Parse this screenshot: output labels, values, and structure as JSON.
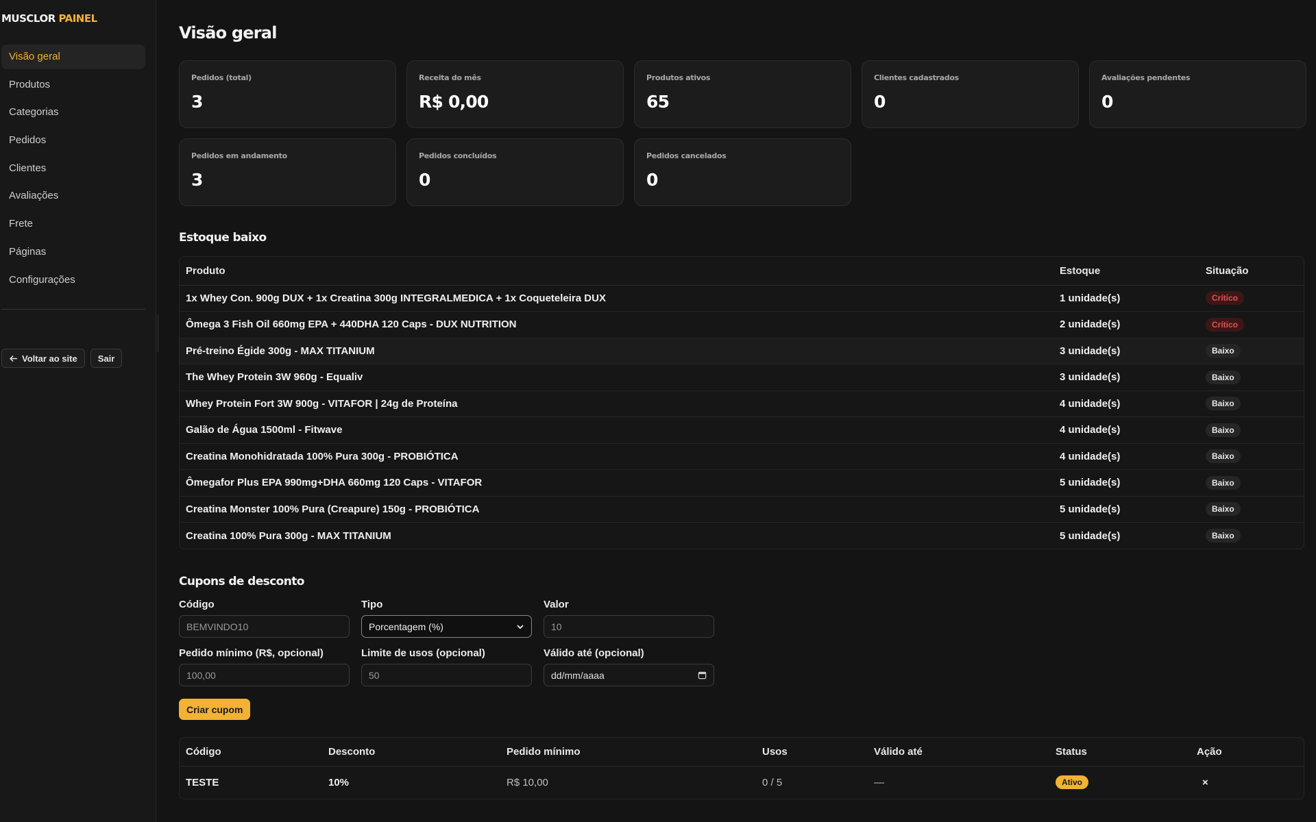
{
  "brand": {
    "name": "MUSCLOR",
    "accent": "PAINEL",
    "accent_color": "#f2b233"
  },
  "sidebar": {
    "items": [
      {
        "label": "Visão geral",
        "active": true
      },
      {
        "label": "Produtos"
      },
      {
        "label": "Categorias"
      },
      {
        "label": "Pedidos"
      },
      {
        "label": "Clientes"
      },
      {
        "label": "Avaliações"
      },
      {
        "label": "Frete"
      },
      {
        "label": "Páginas"
      },
      {
        "label": "Configurações"
      }
    ],
    "back_label": "Voltar ao site",
    "back_icon": "arrow-left-icon",
    "logout_label": "Sair"
  },
  "page": {
    "title": "Visão geral"
  },
  "stats": [
    {
      "label": "Pedidos (total)",
      "value": "3"
    },
    {
      "label": "Receita do mês",
      "value": "R$ 0,00"
    },
    {
      "label": "Produtos ativos",
      "value": "65"
    },
    {
      "label": "Clientes cadastrados",
      "value": "0"
    },
    {
      "label": "Avaliações pendentes",
      "value": "0"
    },
    {
      "label": "Pedidos em andamento",
      "value": "3"
    },
    {
      "label": "Pedidos concluídos",
      "value": "0"
    },
    {
      "label": "Pedidos cancelados",
      "value": "0"
    }
  ],
  "low_stock": {
    "title": "Estoque baixo",
    "headers": {
      "product": "Produto",
      "stock": "Estoque",
      "status": "Situação"
    },
    "rows": [
      {
        "product": "1x Whey Con. 900g DUX + 1x Creatina 300g INTEGRALMEDICA + 1x Coqueteleira DUX",
        "stock": "1 unidade(s)",
        "status": "Crítico",
        "level": "critical"
      },
      {
        "product": "Ômega 3 Fish Oil 660mg EPA + 440DHA 120 Caps - DUX NUTRITION",
        "stock": "2 unidade(s)",
        "status": "Crítico",
        "level": "critical"
      },
      {
        "product": "Pré-treino Égide 300g - MAX TITANIUM",
        "stock": "3 unidade(s)",
        "status": "Baixo",
        "level": "low"
      },
      {
        "product": "The Whey Protein 3W 960g - Equaliv",
        "stock": "3 unidade(s)",
        "status": "Baixo",
        "level": "low"
      },
      {
        "product": "Whey Protein Fort 3W 900g - VITAFOR | 24g de Proteína",
        "stock": "4 unidade(s)",
        "status": "Baixo",
        "level": "low"
      },
      {
        "product": "Galão de Água 1500ml - Fitwave",
        "stock": "4 unidade(s)",
        "status": "Baixo",
        "level": "low"
      },
      {
        "product": "Creatina Monohidratada 100% Pura 300g - PROBIÓTICA",
        "stock": "4 unidade(s)",
        "status": "Baixo",
        "level": "low"
      },
      {
        "product": "Ômegafor Plus EPA 990mg+DHA 660mg 120 Caps - VITAFOR",
        "stock": "5 unidade(s)",
        "status": "Baixo",
        "level": "low"
      },
      {
        "product": "Creatina Monster 100% Pura (Creapure) 150g - PROBIÓTICA",
        "stock": "5 unidade(s)",
        "status": "Baixo",
        "level": "low"
      },
      {
        "product": "Creatina 100% Pura 300g - MAX TITANIUM",
        "stock": "5 unidade(s)",
        "status": "Baixo",
        "level": "low"
      }
    ]
  },
  "coupons": {
    "title": "Cupons de desconto",
    "form": {
      "code": {
        "label": "Código",
        "placeholder": "BEMVINDO10"
      },
      "type": {
        "label": "Tipo",
        "value": "Porcentagem (%)"
      },
      "value": {
        "label": "Valor",
        "placeholder": "10"
      },
      "min_order": {
        "label": "Pedido mínimo (R$, opcional)",
        "placeholder": "100,00"
      },
      "usage_limit": {
        "label": "Limite de usos (opcional)",
        "placeholder": "50"
      },
      "valid_until": {
        "label": "Válido até (opcional)",
        "placeholder": "dd/mm/aaaa"
      },
      "submit_label": "Criar cupom"
    },
    "headers": {
      "code": "Código",
      "discount": "Desconto",
      "min_order": "Pedido mínimo",
      "uses": "Usos",
      "valid_until": "Válido até",
      "status": "Status",
      "action": "Ação"
    },
    "rows": [
      {
        "code": "TESTE",
        "discount": "10%",
        "min_order": "R$ 10,00",
        "uses": "0 / 5",
        "valid_until": "—",
        "status": "Ativo",
        "action": "×"
      }
    ]
  }
}
